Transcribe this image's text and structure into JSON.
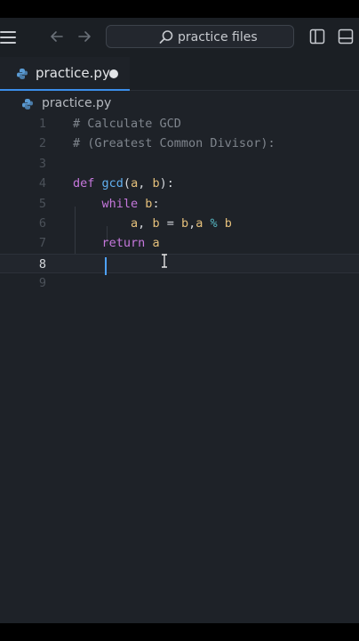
{
  "titlebar": {
    "search_placeholder": "practice files",
    "icons": [
      "menu-icon",
      "back-arrow-icon",
      "forward-arrow-icon",
      "search-icon",
      "split-editor-icon",
      "toggle-panel-icon"
    ]
  },
  "tab": {
    "label": "practice.py",
    "unsaved": true
  },
  "breadcrumb": {
    "file": "practice.py"
  },
  "editor": {
    "line_numbers": [
      "1",
      "2",
      "3",
      "4",
      "5",
      "6",
      "7",
      "8",
      "9"
    ],
    "active_line": "8",
    "lines": [
      [
        {
          "t": "# Calculate GCD",
          "c": "cm"
        }
      ],
      [
        {
          "t": "# (Greatest Common Divisor):",
          "c": "cm"
        }
      ],
      [],
      [
        {
          "t": "def",
          "c": "kw"
        },
        {
          "t": " ",
          "c": "plain"
        },
        {
          "t": "gcd",
          "c": "fn"
        },
        {
          "t": "(",
          "c": "plain"
        },
        {
          "t": "a",
          "c": "pm"
        },
        {
          "t": ", ",
          "c": "plain"
        },
        {
          "t": "b",
          "c": "pm"
        },
        {
          "t": "):",
          "c": "plain"
        }
      ],
      [
        {
          "t": "    ",
          "c": "plain"
        },
        {
          "t": "while",
          "c": "kw"
        },
        {
          "t": " ",
          "c": "plain"
        },
        {
          "t": "b",
          "c": "pm"
        },
        {
          "t": ":",
          "c": "plain"
        }
      ],
      [
        {
          "t": "        ",
          "c": "plain"
        },
        {
          "t": "a",
          "c": "pm"
        },
        {
          "t": ", ",
          "c": "plain"
        },
        {
          "t": "b",
          "c": "pm"
        },
        {
          "t": " = ",
          "c": "plain"
        },
        {
          "t": "b",
          "c": "pm"
        },
        {
          "t": ",",
          "c": "plain"
        },
        {
          "t": "a",
          "c": "pm"
        },
        {
          "t": " % ",
          "c": "op"
        },
        {
          "t": "b",
          "c": "pm"
        }
      ],
      [
        {
          "t": "    ",
          "c": "plain"
        },
        {
          "t": "return",
          "c": "kw"
        },
        {
          "t": " ",
          "c": "plain"
        },
        {
          "t": "a",
          "c": "pm"
        }
      ],
      [],
      []
    ]
  },
  "colors": {
    "background": "#1e2228",
    "accent": "#3b8eea",
    "keyword": "#c678dd",
    "function": "#61afef",
    "parameter": "#e5c07b",
    "comment": "#7f858d"
  }
}
